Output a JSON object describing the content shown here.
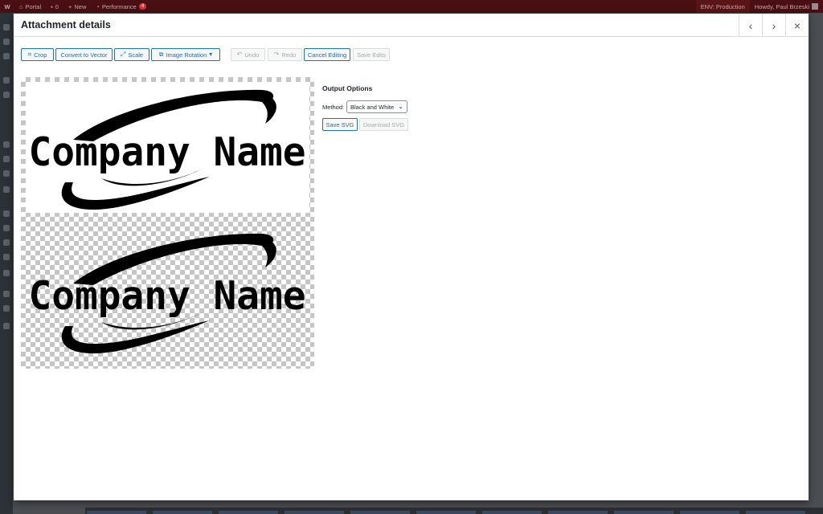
{
  "admin_bar": {
    "site_name": "Portal",
    "comments_count": "0",
    "new_label": "New",
    "performance_label": "Performance",
    "performance_badge": "4",
    "env_label": "ENV: Production",
    "greeting": "Howdy, Paul Brzeski",
    "bg_color": "#4a0f12"
  },
  "modal": {
    "title": "Attachment details",
    "prev_icon": "chevron-left-icon",
    "next_icon": "chevron-right-icon",
    "close_icon": "close-icon"
  },
  "toolbar": {
    "crop_label": "Crop",
    "convert_label": "Convert to Vector",
    "scale_label": "Scale",
    "rotation_label": "Image Rotation",
    "undo_label": "Undo",
    "redo_label": "Redo",
    "cancel_label": "Cancel Editing",
    "save_edits_label": "Save Edits"
  },
  "preview": {
    "logo_text": "Company Name"
  },
  "output_options": {
    "title": "Output Options",
    "method_label": "Method:",
    "method_value": "Black and White",
    "save_svg_label": "Save SVG",
    "download_svg_label": "Download SVG"
  },
  "colors": {
    "accent": "#2271b1",
    "disabled": "#a7aaad"
  }
}
